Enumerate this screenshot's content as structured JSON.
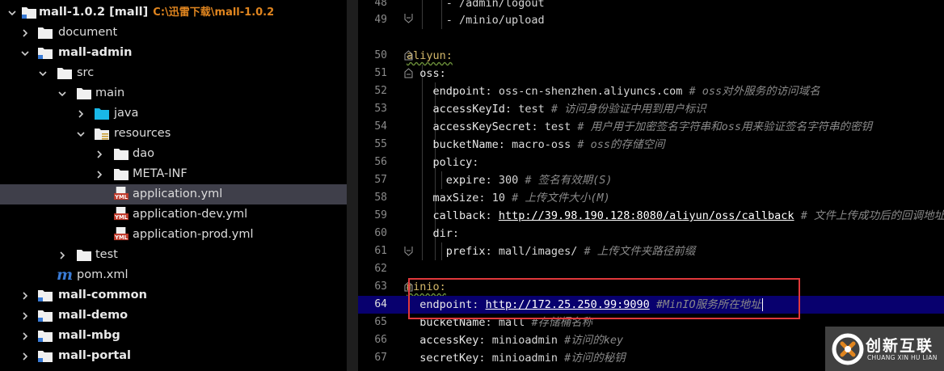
{
  "project_tree": {
    "root": {
      "name": "mall-1.0.2 [mall]",
      "path": "C:\\迅雷下载\\mall-1.0.2"
    },
    "items": [
      {
        "label": "document"
      },
      {
        "label": "mall-admin"
      },
      {
        "label": "src"
      },
      {
        "label": "main"
      },
      {
        "label": "java"
      },
      {
        "label": "resources"
      },
      {
        "label": "dao"
      },
      {
        "label": "META-INF"
      },
      {
        "label": "application.yml",
        "selected": true
      },
      {
        "label": "application-dev.yml"
      },
      {
        "label": "application-prod.yml"
      },
      {
        "label": "test"
      },
      {
        "label": "pom.xml"
      },
      {
        "label": "mall-common"
      },
      {
        "label": "mall-demo"
      },
      {
        "label": "mall-mbg"
      },
      {
        "label": "mall-portal"
      }
    ],
    "yml_badge": "YML",
    "maven_badge": "m"
  },
  "editor": {
    "line_numbers": [
      "48",
      "49",
      "50",
      "51",
      "52",
      "53",
      "54",
      "55",
      "56",
      "57",
      "58",
      "59",
      "60",
      "61",
      "62",
      "63",
      "64",
      "65",
      "66",
      "67"
    ],
    "lines": {
      "l47": "      - /admin/logout",
      "l48": "      - /minio/upload",
      "l50": "aliyun:",
      "l51": "oss:",
      "l52": {
        "key": "endpoint",
        "value": "oss-cn-shenzhen.aliyuncs.com",
        "comment": "# oss对外服务的访问域名"
      },
      "l53": {
        "key": "accessKeyId",
        "value": "test",
        "comment": "# 访问身份验证中用到用户标识"
      },
      "l54": {
        "key": "accessKeySecret",
        "value": "test",
        "comment": "# 用户用于加密签名字符串和oss用来验证签名字符串的密钥"
      },
      "l55": {
        "key": "bucketName",
        "value": "macro-oss",
        "comment": "# oss的存储空间"
      },
      "l56": {
        "key": "policy"
      },
      "l57": {
        "key": "expire",
        "value": "300",
        "comment": "# 签名有效期(S)"
      },
      "l58": {
        "key": "maxSize",
        "value": "10",
        "comment": "# 上传文件大小(M)"
      },
      "l59": {
        "key": "callback",
        "value": "http://39.98.190.128:8080/aliyun/oss/callback",
        "comment": "# 文件上传成功后的回调地址"
      },
      "l60": {
        "key": "dir"
      },
      "l61": {
        "key": "prefix",
        "value": "mall/images/",
        "comment": "# 上传文件夹路径前缀"
      },
      "l63": "minio:",
      "l64": {
        "key": "endpoint",
        "value": "http://172.25.250.99:9090",
        "comment": "#MinIO服务所在地址"
      },
      "l65": {
        "key": "bucketName",
        "value": "mall",
        "comment": "#存储桶名称"
      },
      "l66": {
        "key": "accessKey",
        "value": "minioadmin",
        "comment": "#访问的key"
      },
      "l67": {
        "key": "secretKey",
        "value": "minioadmin",
        "comment": "#访问的秘钥"
      }
    },
    "active_line": "64"
  },
  "watermark": {
    "cn": "创新互联",
    "en": "CHUANG XIN HU LIAN"
  },
  "colors": {
    "highlight": "#08006e",
    "annotation_box": "#e0383b",
    "path_hint": "#e0851f"
  }
}
